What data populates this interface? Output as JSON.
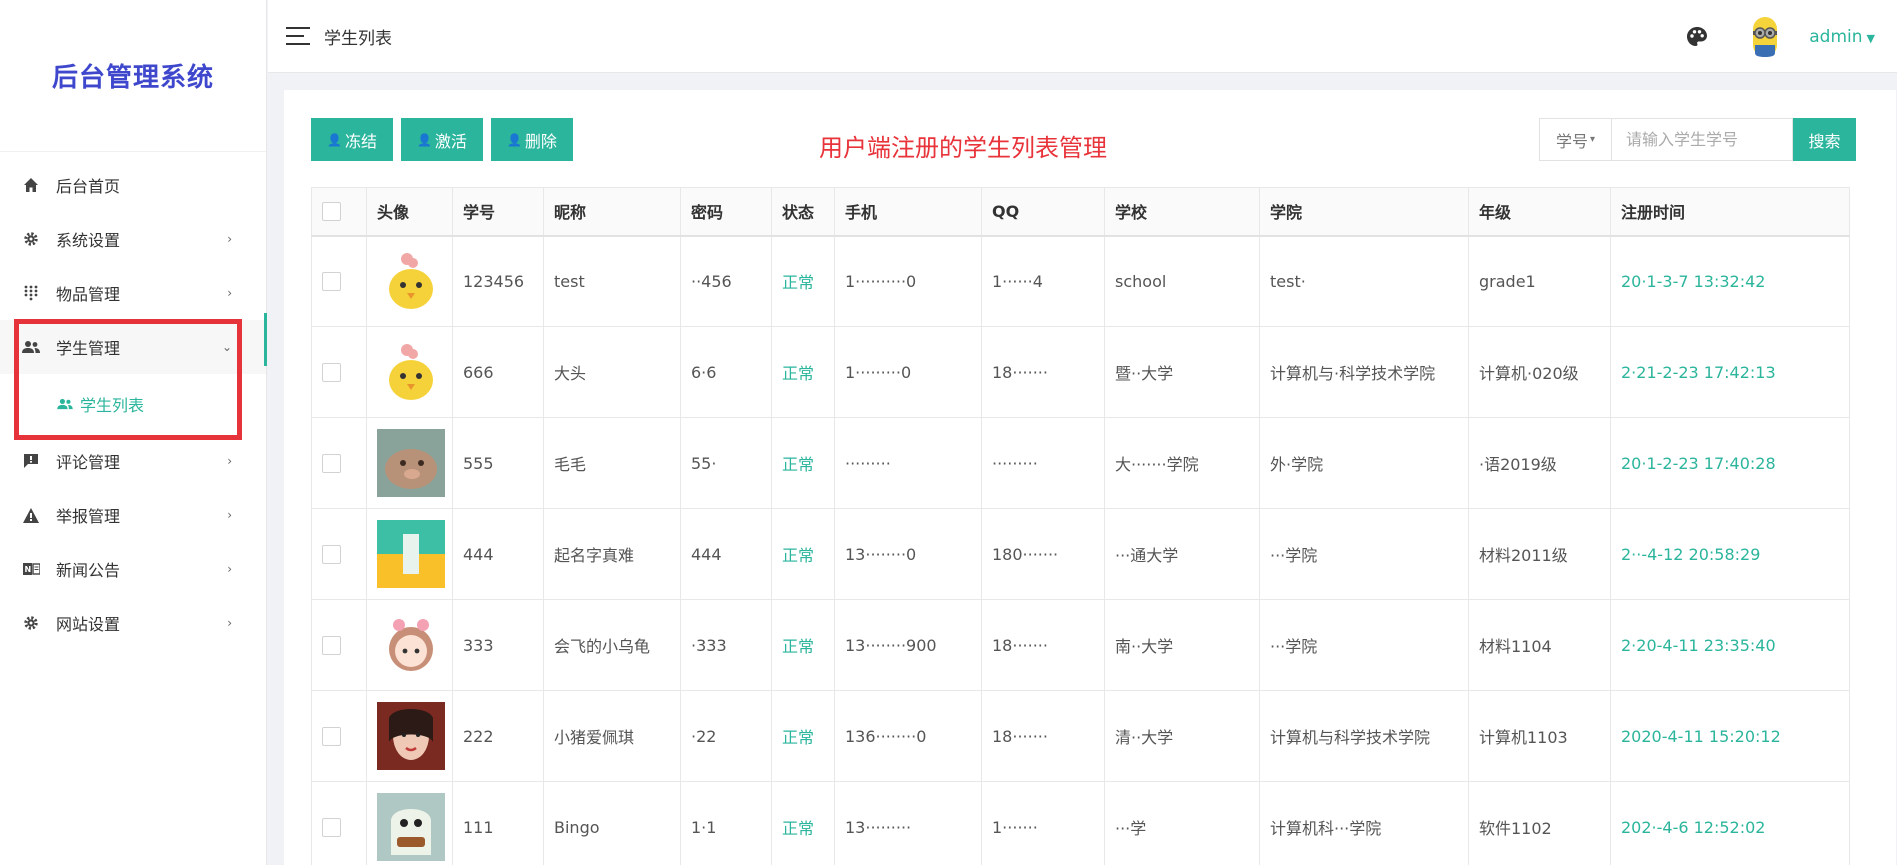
{
  "app": {
    "logo": "后台管理系统",
    "header_title": "学生列表",
    "user_name": "admin"
  },
  "sidebar": {
    "items": [
      {
        "label": "后台首页",
        "icon": "home-icon",
        "has_arrow": false
      },
      {
        "label": "系统设置",
        "icon": "gear-icon",
        "has_arrow": true
      },
      {
        "label": "物品管理",
        "icon": "grid-dots-icon",
        "has_arrow": true
      },
      {
        "label": "学生管理",
        "icon": "users-icon",
        "has_arrow": true,
        "open": true
      },
      {
        "label": "评论管理",
        "icon": "comment-icon",
        "has_arrow": true
      },
      {
        "label": "举报管理",
        "icon": "warning-icon",
        "has_arrow": true
      },
      {
        "label": "新闻公告",
        "icon": "news-icon",
        "has_arrow": true
      },
      {
        "label": "网站设置",
        "icon": "gear-icon",
        "has_arrow": true
      }
    ],
    "subitem": {
      "label": "学生列表",
      "icon": "users-icon"
    }
  },
  "toolbar": {
    "freeze_label": "冻结",
    "activate_label": "激活",
    "delete_label": "删除"
  },
  "notice": "用户端注册的学生列表管理",
  "search": {
    "field": "学号",
    "placeholder": "请输入学生学号",
    "button_label": "搜索"
  },
  "table": {
    "columns": [
      "头像",
      "学号",
      "昵称",
      "密码",
      "状态",
      "手机",
      "QQ",
      "学校",
      "学院",
      "年级",
      "注册时间"
    ],
    "rows": [
      {
        "avatar": "chick",
        "sid": "123456",
        "nick": "test",
        "pwd": "··456",
        "status": "正常",
        "phone": "1··········0",
        "qq": "1······4",
        "school": "school",
        "college": "test·",
        "grade": "grade1",
        "regtime": "20·1-3-7 13:32:42"
      },
      {
        "avatar": "chick",
        "sid": "666",
        "nick": "大头",
        "pwd": "6·6",
        "status": "正常",
        "phone": "1·········0",
        "qq": "18·······",
        "school": "暨··大学",
        "college": "计算机与·科学技术学院",
        "grade": "计算机·020级",
        "regtime": "2·21-2-23 17:42:13"
      },
      {
        "avatar": "pig",
        "sid": "555",
        "nick": "毛毛",
        "pwd": "55·",
        "status": "正常",
        "phone": "·········",
        "qq": "·········",
        "school": "大·······学院",
        "college": "外·学院",
        "grade": "·语2019级",
        "regtime": "20·1-2-23 17:40:28"
      },
      {
        "avatar": "green",
        "sid": "444",
        "nick": "起名字真难",
        "pwd": "444",
        "status": "正常",
        "phone": "13········0",
        "qq": "180·······",
        "school": "···通大学",
        "college": "···学院",
        "grade": "材料2011级",
        "regtime": "2··-4-12 20:58:29"
      },
      {
        "avatar": "girl",
        "sid": "333",
        "nick": "会飞的小乌龟",
        "pwd": "·333",
        "status": "正常",
        "phone": "13········900",
        "qq": "18·······",
        "school": "南··大学",
        "college": "···学院",
        "grade": "材料1104",
        "regtime": "2·20-4-11 23:35:40"
      },
      {
        "avatar": "photo",
        "sid": "222",
        "nick": "小猪爱佩琪",
        "pwd": "·22",
        "status": "正常",
        "phone": "136········0",
        "qq": "18·······",
        "school": "清··大学",
        "college": "计算机与科学技术学院",
        "grade": "计算机1103",
        "regtime": "2020-4-11 15:20:12"
      },
      {
        "avatar": "ghost",
        "sid": "111",
        "nick": "Bingo",
        "pwd": "1·1",
        "status": "正常",
        "phone": "13·········",
        "qq": "1·······",
        "school": "···学",
        "college": "计算机科···学院",
        "grade": "软件1102",
        "regtime": "202·-4-6 12:52:02"
      }
    ]
  },
  "colors": {
    "accent": "#2bb59c",
    "logo": "#3f48cc",
    "notice": "#e8333a",
    "highlight": "#e63239"
  }
}
